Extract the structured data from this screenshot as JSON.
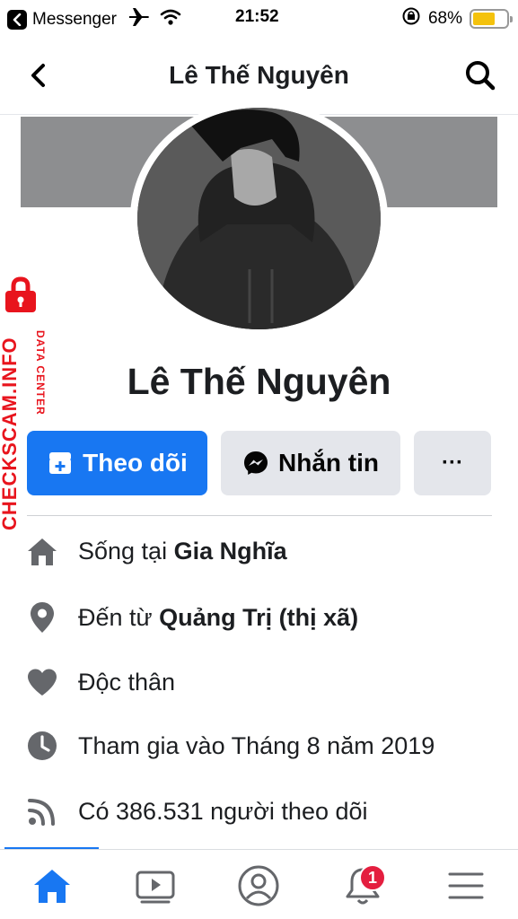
{
  "status_bar": {
    "back_app": "Messenger",
    "time": "21:52",
    "battery_percent": "68%",
    "battery_level": 0.68
  },
  "nav": {
    "title": "Lê Thế Nguyên"
  },
  "profile": {
    "name": "Lê Thế Nguyên"
  },
  "watermark": {
    "main": "CHECKSCAM.INFO",
    "sub": "DATA CENTER"
  },
  "actions": {
    "follow": "Theo dõi",
    "message": "Nhắn tin",
    "more": "···"
  },
  "info": {
    "lives_prefix": "Sống tại ",
    "lives_value": "Gia Nghĩa",
    "from_prefix": "Đến từ ",
    "from_value": "Quảng Trị (thị xã)",
    "relationship": "Độc thân",
    "joined": "Tham gia vào Tháng 8 năm 2019",
    "followers": "Có 386.531 người theo dõi"
  },
  "tabs": {
    "notifications_badge": "1"
  },
  "colors": {
    "accent": "#1877f2",
    "badge": "#e41e3f",
    "watermark": "#e8141d",
    "icon_gray": "#65676b"
  }
}
